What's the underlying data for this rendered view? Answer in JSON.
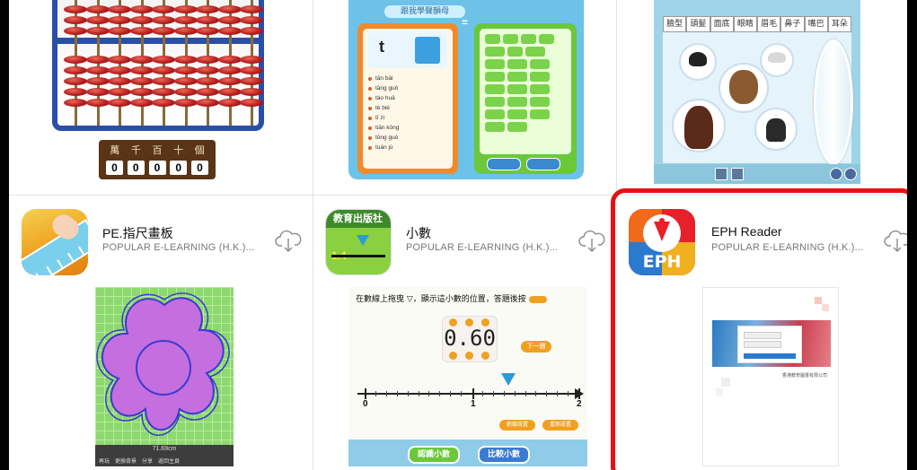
{
  "abacus": {
    "place_labels": [
      "萬",
      "千",
      "百",
      "十",
      "個"
    ],
    "digits": [
      "0",
      "0",
      "0",
      "0",
      "0"
    ]
  },
  "pinyin_book": {
    "title": "跟我學聲韻母",
    "letter": "t",
    "equals": "=",
    "words": [
      "tān bǎi",
      "tāng guǒ",
      "táo huā",
      "tè bié",
      "tī zi",
      "tiān kōng",
      "tōng guò",
      "tuán jù"
    ]
  },
  "face_builder": {
    "tabs": [
      "臉型",
      "頭髮",
      "面底",
      "眼睛",
      "眉毛",
      "鼻子",
      "嘴巴",
      "耳朵"
    ]
  },
  "apps": [
    {
      "name": "PE.指尺畫板",
      "developer": "POPULAR E-LEARNING (H.K.)...",
      "icon": "ruler-finger-icon",
      "preview_status": "71.69cm",
      "preview_menu": [
        "再玩",
        "更換背景",
        "分享",
        "返回主頁"
      ]
    },
    {
      "name": "小數",
      "developer": "POPULAR E-LEARNING (H.K.)...",
      "icon": "number-line-icon",
      "icon_header": "教育出版社",
      "icon_value": "1.4",
      "preview_question": "在數線上拖曳 ▽，顯示這小數的位置，答題後按",
      "preview_reading": "0.60",
      "preview_next": "下一題",
      "preview_axis": [
        "0",
        "1",
        "2"
      ],
      "preview_small_buttons": [
        "數線設置",
        "重新設置"
      ],
      "preview_bottom_buttons": [
        "認識小數",
        "比較小數"
      ]
    },
    {
      "name": "EPH Reader",
      "developer": "POPULAR E-LEARNING (H.K.)...",
      "icon": "eph-logo-icon",
      "icon_text": "EPH",
      "preview_footer": "香港教育圖書有限公司",
      "highlighted": true
    }
  ],
  "colors": {
    "highlight": "#e81010",
    "download_icon": "#8a8a8a"
  }
}
